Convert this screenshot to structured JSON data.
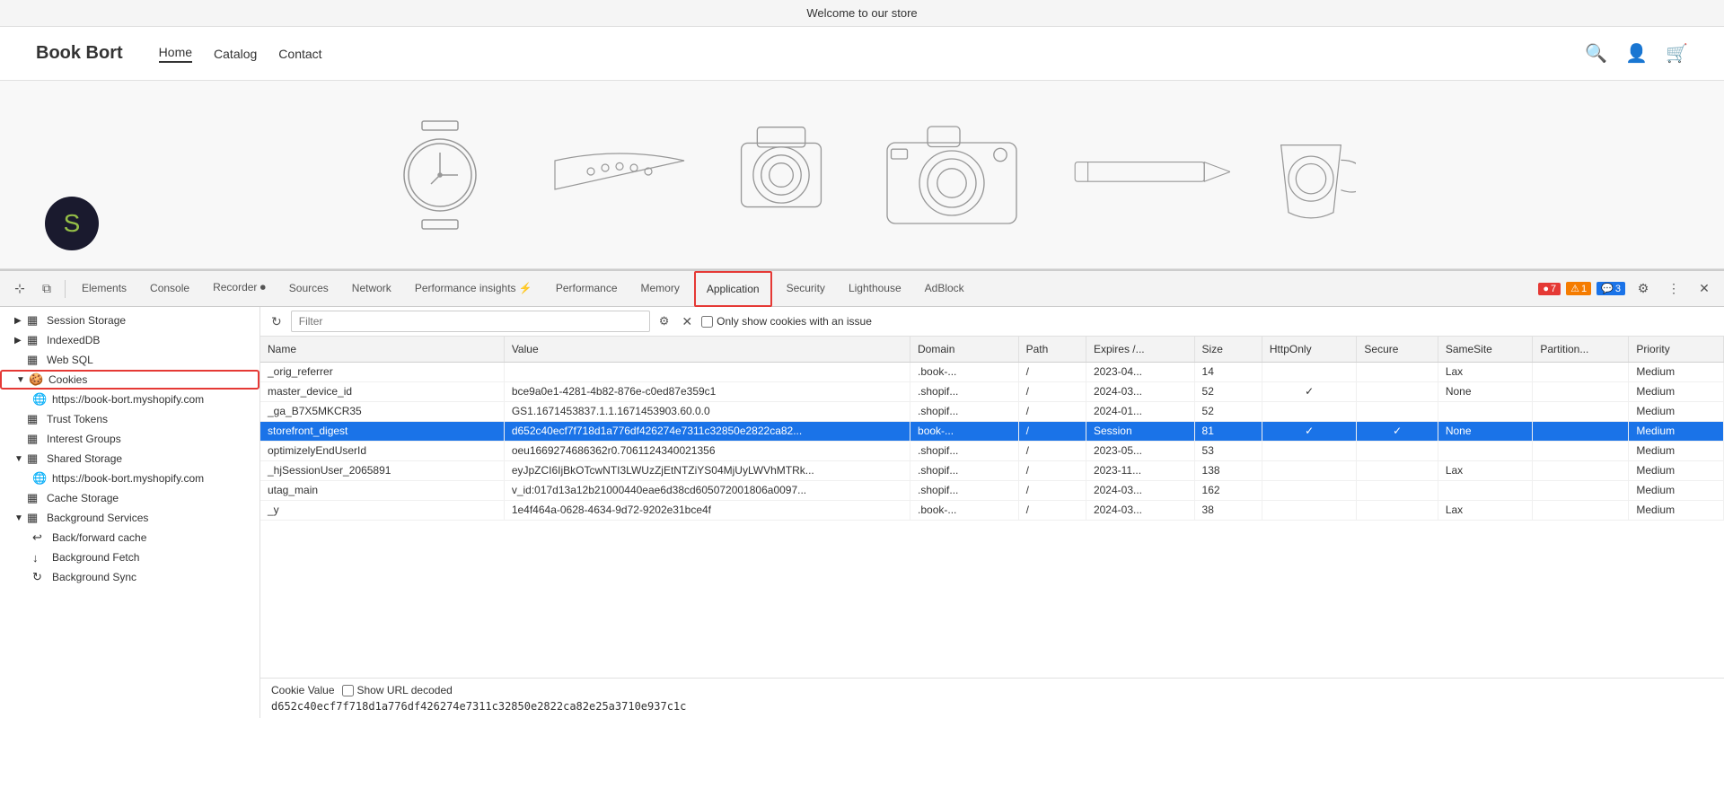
{
  "website": {
    "tab_title": "Welcome to our store",
    "brand": "Book Bort",
    "nav_links": [
      {
        "label": "Home",
        "active": true
      },
      {
        "label": "Catalog",
        "active": false
      },
      {
        "label": "Contact",
        "active": false
      }
    ]
  },
  "devtools": {
    "tabs": [
      {
        "label": "Elements",
        "active": false
      },
      {
        "label": "Console",
        "active": false
      },
      {
        "label": "Recorder ⏺",
        "active": false
      },
      {
        "label": "Sources",
        "active": false
      },
      {
        "label": "Network",
        "active": false
      },
      {
        "label": "Performance insights ⚡",
        "active": false
      },
      {
        "label": "Performance",
        "active": false
      },
      {
        "label": "Memory",
        "active": false
      },
      {
        "label": "Application",
        "active": true
      },
      {
        "label": "Security",
        "active": false
      },
      {
        "label": "Lighthouse",
        "active": false
      },
      {
        "label": "AdBlock",
        "active": false
      }
    ],
    "badges": {
      "error_count": "7",
      "warn_count": "1",
      "info_count": "3"
    }
  },
  "sidebar": {
    "items": [
      {
        "id": "session-storage",
        "label": "Session Storage",
        "icon": "▦",
        "expandable": true,
        "expanded": false,
        "indent": 0
      },
      {
        "id": "indexeddb",
        "label": "IndexedDB",
        "icon": "▦",
        "expandable": true,
        "expanded": false,
        "indent": 0
      },
      {
        "id": "web-sql",
        "label": "Web SQL",
        "icon": "▦",
        "expandable": false,
        "expanded": false,
        "indent": 0
      },
      {
        "id": "cookies",
        "label": "Cookies",
        "icon": "🍪",
        "expandable": true,
        "expanded": true,
        "highlighted": true,
        "indent": 0
      },
      {
        "id": "cookies-url",
        "label": "https://book-bort.myshopify.com",
        "icon": "🌐",
        "expandable": false,
        "expanded": false,
        "indent": 1,
        "selected": false
      },
      {
        "id": "trust-tokens",
        "label": "Trust Tokens",
        "icon": "▦",
        "expandable": false,
        "expanded": false,
        "indent": 0
      },
      {
        "id": "interest-groups",
        "label": "Interest Groups",
        "icon": "▦",
        "expandable": false,
        "expanded": false,
        "indent": 0
      },
      {
        "id": "shared-storage",
        "label": "Shared Storage",
        "icon": "▦",
        "expandable": true,
        "expanded": false,
        "indent": 0
      },
      {
        "id": "shared-storage-url",
        "label": "https://book-bort.myshopify.com",
        "icon": "🌐",
        "expandable": false,
        "expanded": false,
        "indent": 1
      },
      {
        "id": "cache-storage",
        "label": "Cache Storage",
        "icon": "▦",
        "expandable": false,
        "expanded": false,
        "indent": 0
      },
      {
        "id": "background-services",
        "label": "Background Services",
        "icon": "▦",
        "expandable": true,
        "expanded": true,
        "indent": 0
      },
      {
        "id": "back-forward-cache",
        "label": "Back/forward cache",
        "icon": "↩",
        "expandable": false,
        "expanded": false,
        "indent": 1
      },
      {
        "id": "background-fetch",
        "label": "Background Fetch",
        "icon": "↓",
        "expandable": false,
        "expanded": false,
        "indent": 1
      },
      {
        "id": "background-sync",
        "label": "Background Sync",
        "icon": "↻",
        "expandable": false,
        "expanded": false,
        "indent": 1
      }
    ]
  },
  "filter": {
    "placeholder": "Filter",
    "value": "",
    "show_issues_only_label": "Only show cookies with an issue"
  },
  "cookie_table": {
    "columns": [
      "Name",
      "Value",
      "Domain",
      "Path",
      "Expires /...",
      "Size",
      "HttpOnly",
      "Secure",
      "SameSite",
      "Partition...",
      "Priority"
    ],
    "rows": [
      {
        "name": "_orig_referrer",
        "value": "",
        "domain": ".book-...",
        "path": "/",
        "expires": "2023-04...",
        "size": "14",
        "httpOnly": "",
        "secure": "",
        "sameSite": "Lax",
        "partition": "",
        "priority": "Medium",
        "selected": false
      },
      {
        "name": "master_device_id",
        "value": "bce9a0e1-4281-4b82-876e-c0ed87e359c1",
        "domain": ".shopif...",
        "path": "/",
        "expires": "2024-03...",
        "size": "52",
        "httpOnly": "✓",
        "secure": "",
        "sameSite": "None",
        "partition": "",
        "priority": "Medium",
        "selected": false
      },
      {
        "name": "_ga_B7X5MKCR35",
        "value": "GS1.1671453837.1.1.1671453903.60.0.0",
        "domain": ".shopif...",
        "path": "/",
        "expires": "2024-01...",
        "size": "52",
        "httpOnly": "",
        "secure": "",
        "sameSite": "",
        "partition": "",
        "priority": "Medium",
        "selected": false
      },
      {
        "name": "storefront_digest",
        "value": "d652c40ecf7f718d1a776df426274e7311c32850e2822ca82...",
        "domain": "book-...",
        "path": "/",
        "expires": "Session",
        "size": "81",
        "httpOnly": "✓",
        "secure": "✓",
        "sameSite": "None",
        "partition": "",
        "priority": "Medium",
        "selected": true
      },
      {
        "name": "optimizelyEndUserId",
        "value": "oeu1669274686362r0.7061124340021356",
        "domain": ".shopif...",
        "path": "/",
        "expires": "2023-05...",
        "size": "53",
        "httpOnly": "",
        "secure": "",
        "sameSite": "",
        "partition": "",
        "priority": "Medium",
        "selected": false
      },
      {
        "name": "_hjSessionUser_2065891",
        "value": "eyJpZCI6IjBkOTcwNTI3LWUzZjEtNTZiYS04MjUyLWVhMTRk...",
        "domain": ".shopif...",
        "path": "/",
        "expires": "2023-11...",
        "size": "138",
        "httpOnly": "",
        "secure": "",
        "sameSite": "Lax",
        "partition": "",
        "priority": "Medium",
        "selected": false
      },
      {
        "name": "utag_main",
        "value": "v_id:017d13a12b21000440eae6d38cd605072001806a0097...",
        "domain": ".shopif...",
        "path": "/",
        "expires": "2024-03...",
        "size": "162",
        "httpOnly": "",
        "secure": "",
        "sameSite": "",
        "partition": "",
        "priority": "Medium",
        "selected": false
      },
      {
        "name": "_y",
        "value": "1e4f464a-0628-4634-9d72-9202e31bce4f",
        "domain": ".book-...",
        "path": "/",
        "expires": "2024-03...",
        "size": "38",
        "httpOnly": "",
        "secure": "",
        "sameSite": "Lax",
        "partition": "",
        "priority": "Medium",
        "selected": false
      }
    ]
  },
  "cookie_value": {
    "label": "Cookie Value",
    "show_url_decoded_label": "Show URL decoded",
    "value": "d652c40ecf7f718d1a776df426274e7311c32850e2822ca82e25a3710e937c1c"
  }
}
